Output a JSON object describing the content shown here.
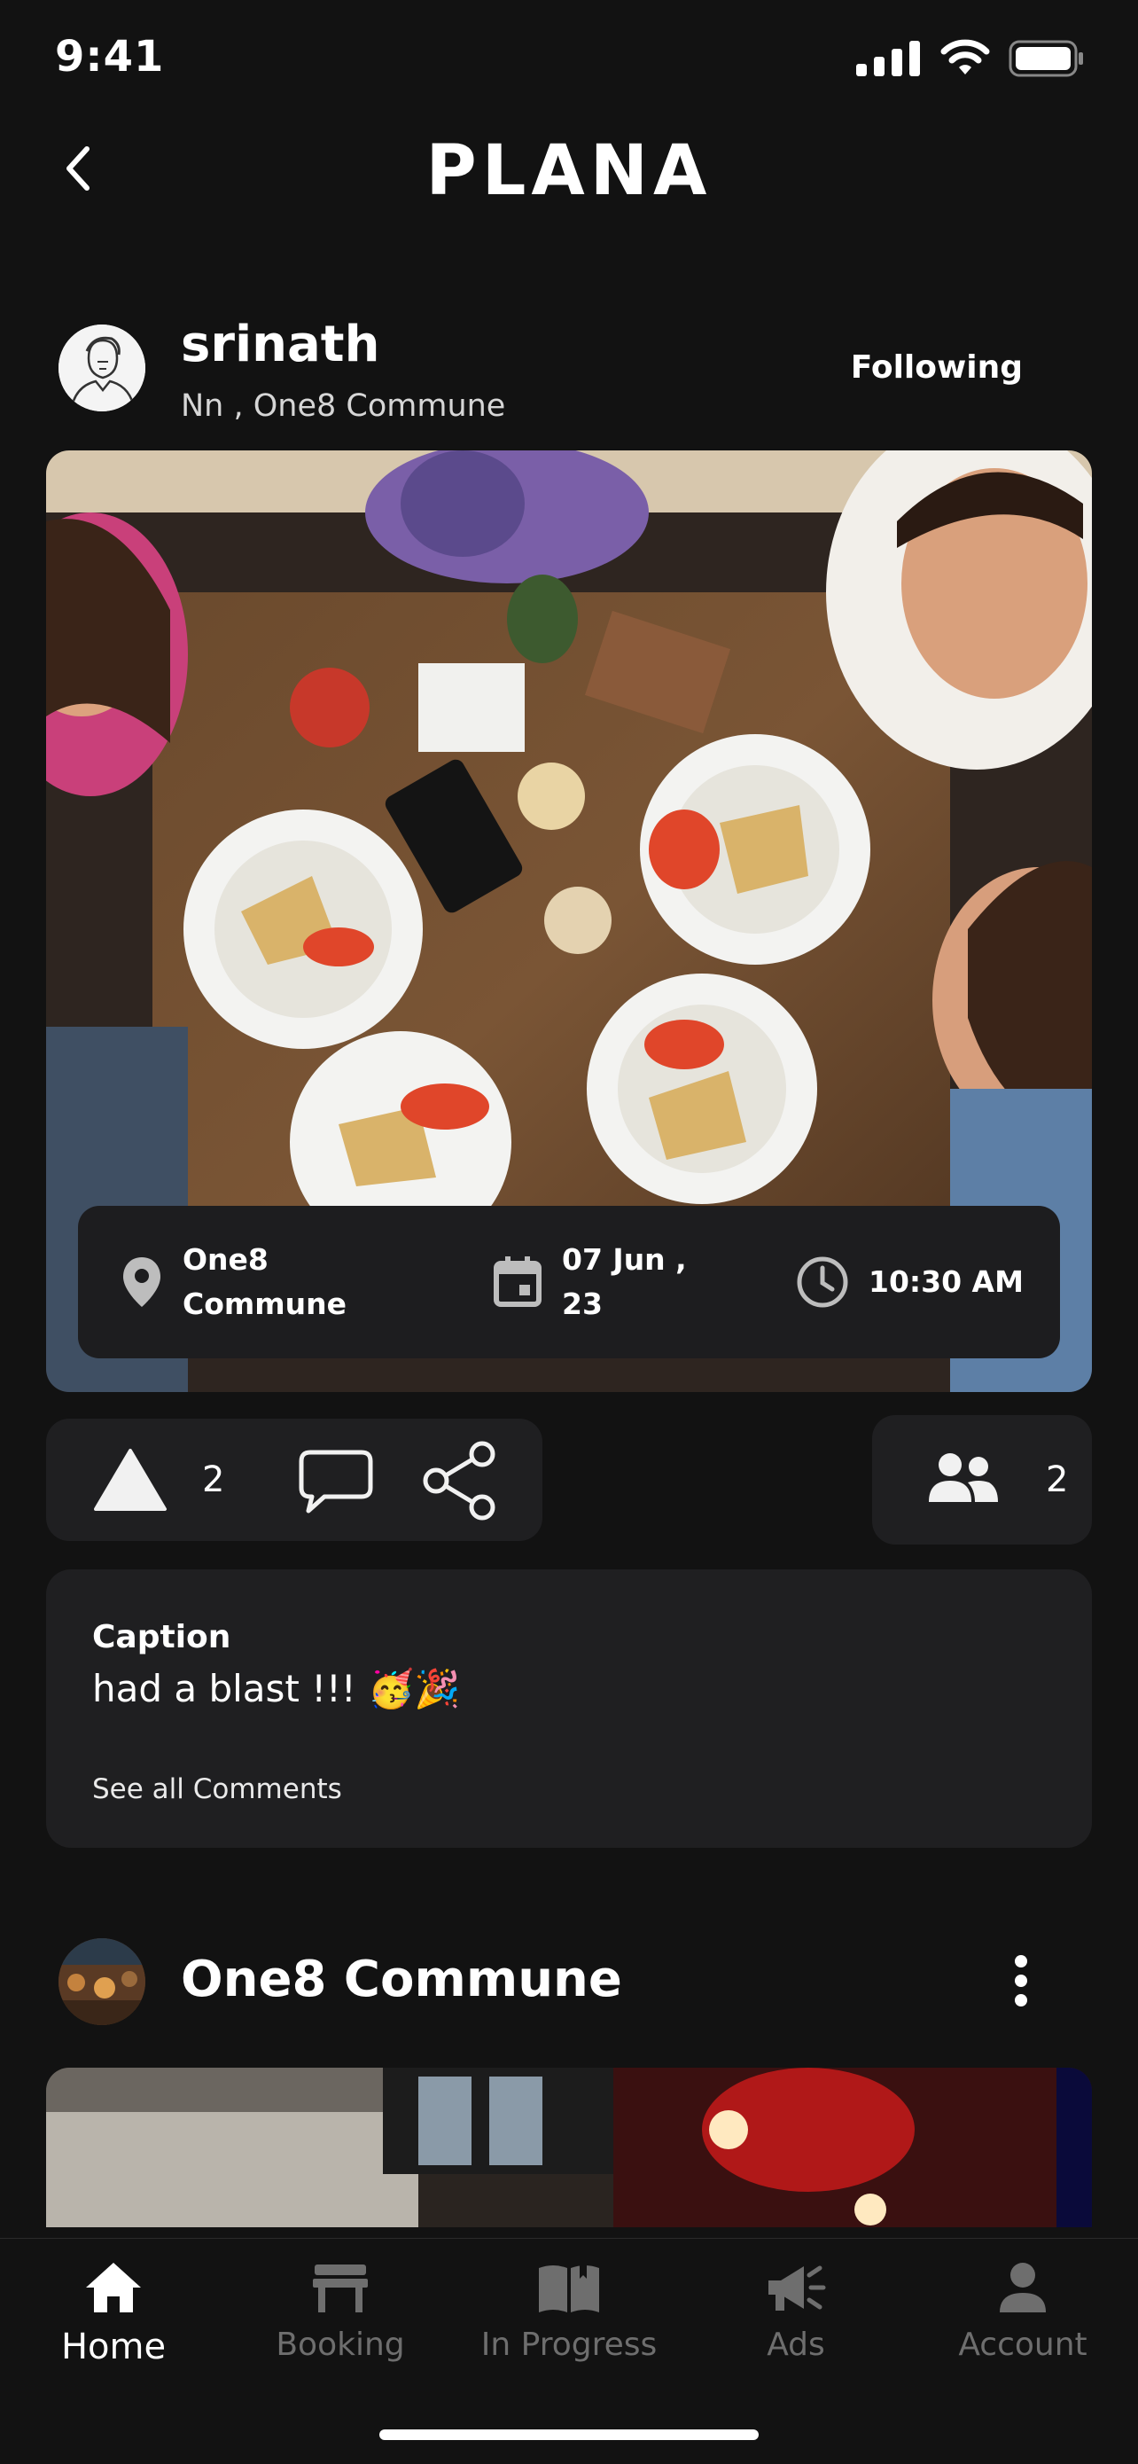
{
  "status": {
    "time": "9:41"
  },
  "header": {
    "brand": "PLANA"
  },
  "post": {
    "user_name": "srinath",
    "user_sub": "Nn , One8 Commune",
    "follow_label": "Following",
    "location_line1": "One8",
    "location_line2": "Commune",
    "date_line1": "07 Jun ,",
    "date_line2": "23",
    "time": "10:30 AM",
    "likes": "2",
    "participants": "2",
    "caption_label": "Caption",
    "caption_text": "had a blast !!! 🥳🎉",
    "see_comments": "See all Comments"
  },
  "next_post": {
    "venue": "One8 Commune"
  },
  "tabs": [
    {
      "label": "Home",
      "icon": "home-icon",
      "active": true
    },
    {
      "label": "Booking",
      "icon": "table-icon"
    },
    {
      "label": "In Progress",
      "icon": "book-icon"
    },
    {
      "label": "Ads",
      "icon": "megaphone-icon"
    },
    {
      "label": "Account",
      "icon": "person-icon"
    }
  ],
  "colors": {
    "background": "#121212",
    "card": "#1f1f21",
    "text": "#ffffff",
    "inactive": "#6e6e6e"
  }
}
